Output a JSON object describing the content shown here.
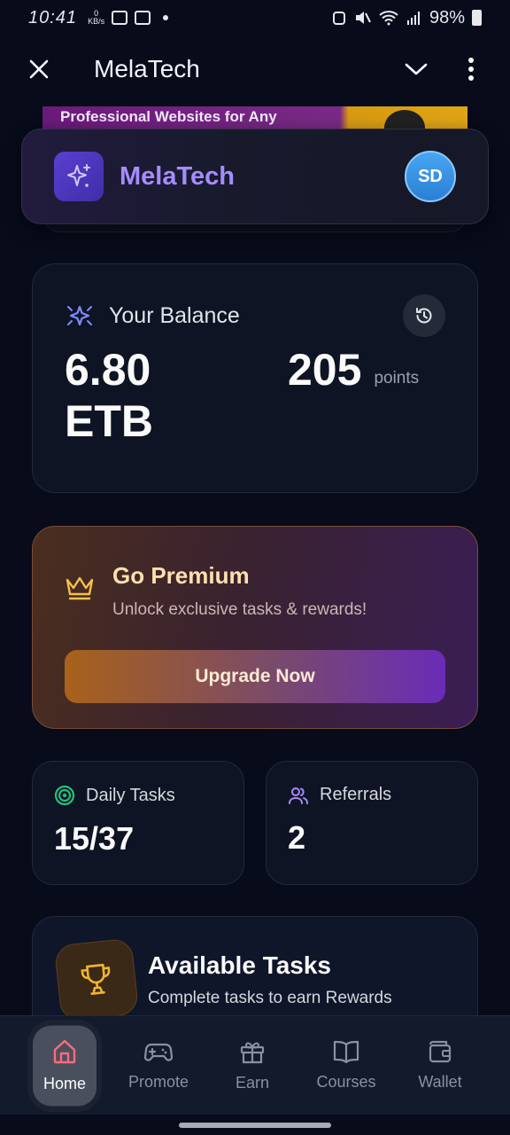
{
  "status_bar": {
    "time": "10:41",
    "net_speed_value": "0",
    "net_speed_unit": "KB/s",
    "battery": "98%"
  },
  "app_bar": {
    "title": "MelaTech"
  },
  "banner": {
    "text": "Professional Websites for Any"
  },
  "brand": {
    "name": "MelaTech",
    "avatar_initials": "SD"
  },
  "balance": {
    "label": "Your Balance",
    "money_amount": "6.80",
    "money_currency": "ETB",
    "points_value": "205",
    "points_unit": "points"
  },
  "premium": {
    "title": "Go Premium",
    "subtitle": "Unlock exclusive tasks & rewards!",
    "button_label": "Upgrade Now"
  },
  "stats": {
    "daily_tasks": {
      "label": "Daily Tasks",
      "value": "15/37"
    },
    "referrals": {
      "label": "Referrals",
      "value": "2"
    }
  },
  "tasks": {
    "title": "Available Tasks",
    "subtitle": "Complete tasks to earn Rewards"
  },
  "bottom_nav": {
    "items": [
      {
        "label": "Home",
        "icon": "home-icon"
      },
      {
        "label": "Promote",
        "icon": "gamepad-icon"
      },
      {
        "label": "Earn",
        "icon": "gift-icon"
      },
      {
        "label": "Courses",
        "icon": "book-icon"
      },
      {
        "label": "Wallet",
        "icon": "wallet-icon"
      }
    ],
    "active": "Home"
  },
  "colors": {
    "background": "#070b1a",
    "brand_accent": "#a58cff",
    "premium_title": "#fde0b0",
    "crown": "#f2c14e",
    "daily_tasks_icon": "#22c27a",
    "referrals_icon": "#a78bfa",
    "home_active": "#ff6b7a"
  }
}
